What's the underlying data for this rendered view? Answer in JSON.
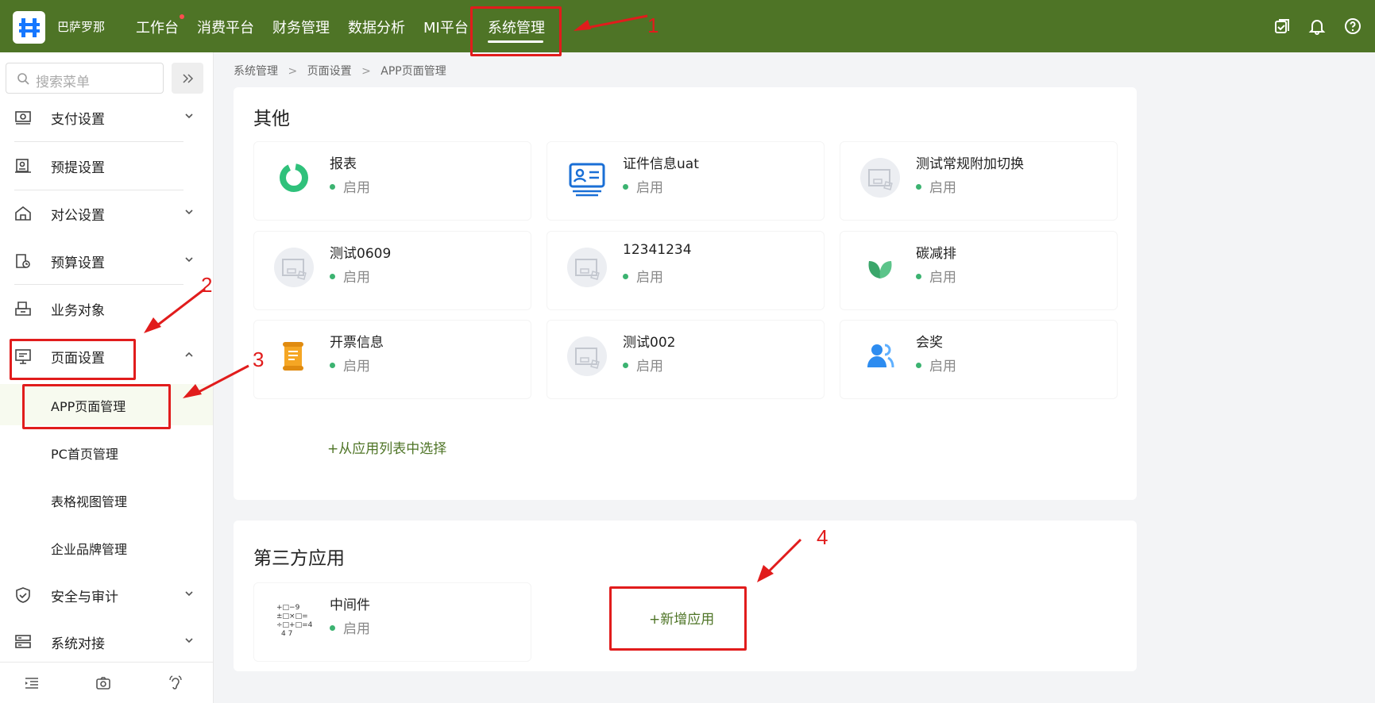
{
  "header": {
    "org_name": "巴萨罗那",
    "nav": [
      "工作台",
      "消费平台",
      "财务管理",
      "数据分析",
      "MI平台",
      "系统管理"
    ],
    "active_nav": "系统管理",
    "icons": [
      "task-check-icon",
      "bell-icon",
      "help-icon"
    ]
  },
  "sidebar": {
    "search_placeholder": "搜索菜单",
    "items": [
      {
        "label": "支付设置",
        "icon": "payment-icon",
        "expandable": true
      },
      {
        "label": "预提设置",
        "icon": "accrual-icon",
        "expandable": false
      },
      {
        "label": "对公设置",
        "icon": "home-icon",
        "expandable": true
      },
      {
        "label": "预算设置",
        "icon": "budget-icon",
        "expandable": true
      },
      {
        "label": "业务对象",
        "icon": "object-icon",
        "expandable": false
      },
      {
        "label": "页面设置",
        "icon": "page-icon",
        "expandable": true,
        "expanded": true
      },
      {
        "label": "安全与审计",
        "icon": "shield-icon",
        "expandable": true
      },
      {
        "label": "系统对接",
        "icon": "server-icon",
        "expandable": true
      }
    ],
    "sub_items": [
      "APP页面管理",
      "PC首页管理",
      "表格视图管理",
      "企业品牌管理"
    ],
    "active_sub": "APP页面管理"
  },
  "breadcrumb": [
    "系统管理",
    "页面设置",
    "APP页面管理"
  ],
  "sections": {
    "other": {
      "title": "其他",
      "apps": [
        {
          "name": "报表",
          "status": "启用"
        },
        {
          "name": "证件信息uat",
          "status": "启用"
        },
        {
          "name": "测试常规附加切换",
          "status": "启用"
        },
        {
          "name": "测试0609",
          "status": "启用"
        },
        {
          "name": "12341234",
          "status": "启用"
        },
        {
          "name": "碳减排",
          "status": "启用"
        },
        {
          "name": "开票信息",
          "status": "启用"
        },
        {
          "name": "测试002",
          "status": "启用"
        },
        {
          "name": "会奖",
          "status": "启用"
        }
      ],
      "add_link": "+从应用列表中选择"
    },
    "third_party": {
      "title": "第三方应用",
      "apps": [
        {
          "name": "中间件",
          "status": "启用"
        }
      ],
      "add_button": "+新增应用"
    }
  },
  "annotations": [
    "1",
    "2",
    "3",
    "4"
  ],
  "colors": {
    "header_bg": "#4e7426",
    "annotation": "#e11c1c",
    "status_green": "#3cb371",
    "link_green": "#4e7426"
  }
}
